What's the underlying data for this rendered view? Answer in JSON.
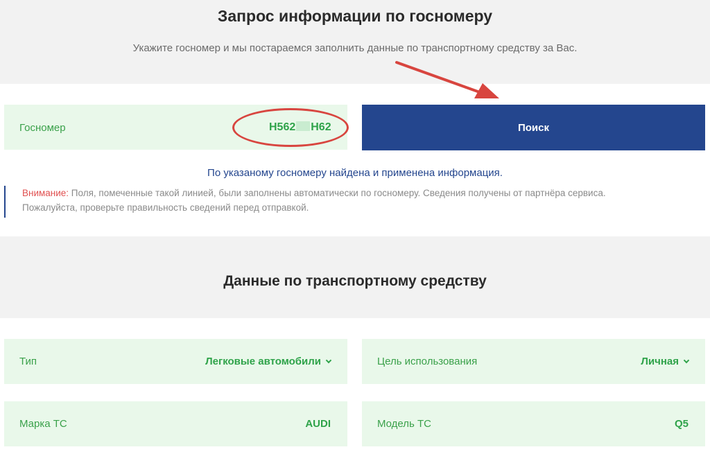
{
  "header": {
    "title": "Запрос информации по госномеру",
    "subtitle": "Укажите госномер и мы постараемся заполнить данные по транспортному средству за Вас."
  },
  "plate": {
    "label": "Госномер",
    "value_start": "Н562",
    "value_end": "Н62"
  },
  "search_button": {
    "label": "Поиск"
  },
  "result": {
    "found_text": "По указаному госномеру найдена и применена информация."
  },
  "notice": {
    "warning_label": "Внимание:",
    "text_line1": " Поля, помеченные такой линией, были заполнены автоматически по госномеру. Сведения получены от партнёра сервиса.",
    "text_line2": "Пожалуйста, проверьте правильность сведений перед отправкой."
  },
  "vehicle": {
    "title": "Данные по транспортному средству",
    "type": {
      "label": "Тип",
      "value": "Легковые автомобили"
    },
    "purpose": {
      "label": "Цель использования",
      "value": "Личная"
    },
    "brand": {
      "label": "Марка ТС",
      "value": "AUDI"
    },
    "model": {
      "label": "Модель ТС",
      "value": "Q5"
    }
  },
  "colors": {
    "accent_blue": "#24468e",
    "field_bg": "#e9f8ea",
    "green_text": "#2fa34a",
    "annotation_red": "#d8453f"
  }
}
